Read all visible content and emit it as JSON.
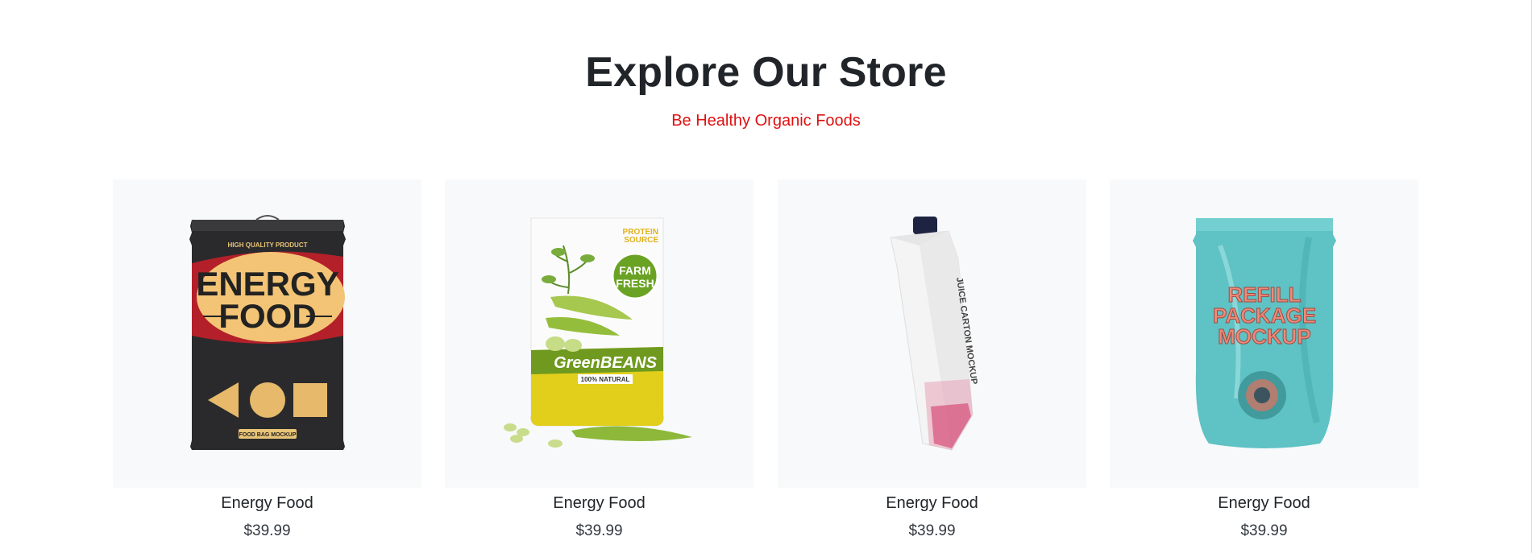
{
  "header": {
    "title": "Explore Our Store",
    "subtitle": "Be Healthy Organic Foods"
  },
  "colors": {
    "accent": "#e01010",
    "card_background": "#f8f9fa",
    "text": "#212529"
  },
  "products": [
    {
      "name": "Energy Food",
      "price": "$39.99",
      "image": "energy-food-bag",
      "image_text": {
        "top": "HIGH QUALITY PRODUCT",
        "line1": "ENERGY",
        "line2": "FOOD",
        "bottom": "FOOD BAG MOCKUP"
      }
    },
    {
      "name": "Energy Food",
      "price": "$39.99",
      "image": "green-beans-pouch",
      "image_text": {
        "corner1": "PROTEIN",
        "corner2": "SOURCE",
        "badge1": "FARM",
        "badge2": "FRESH",
        "brand": "GreenBEANS",
        "tag": "100% NATURAL"
      }
    },
    {
      "name": "Energy Food",
      "price": "$39.99",
      "image": "juice-carton",
      "image_text": {
        "label": "JUICE CARTON MOCKUP"
      }
    },
    {
      "name": "Energy Food",
      "price": "$39.99",
      "image": "refill-pouch",
      "image_text": {
        "line1": "REFILL",
        "line2": "PACKAGE",
        "line3": "MOCKUP"
      }
    }
  ]
}
